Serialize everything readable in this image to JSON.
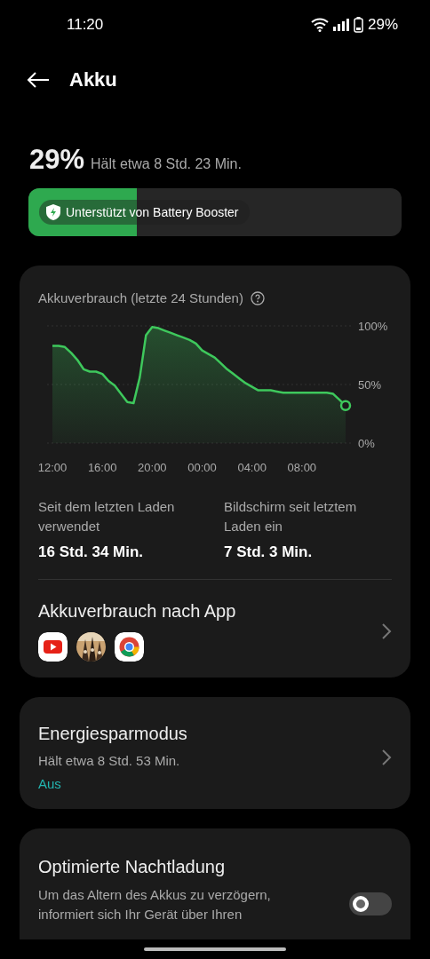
{
  "status_bar": {
    "time": "11:20",
    "battery_text": "29%"
  },
  "header": {
    "title": "Akku"
  },
  "battery": {
    "percent": "29%",
    "estimate": "Hält etwa 8 Std. 23 Min.",
    "level": 0.29,
    "badge": "Unterstützt von Battery Booster"
  },
  "usage_card": {
    "title": "Akkuverbrauch (letzte 24 Stunden)",
    "chart_data": {
      "type": "area",
      "categories": [
        "12:00",
        null,
        null,
        null,
        null,
        null,
        null,
        null,
        "16:00",
        null,
        null,
        null,
        null,
        null,
        null,
        null,
        "20:00",
        null,
        null,
        null,
        null,
        null,
        null,
        null,
        "00:00",
        null,
        null,
        null,
        null,
        null,
        null,
        null,
        "04:00",
        null,
        null,
        null,
        null,
        null,
        null,
        null,
        "08:00",
        null,
        null,
        null,
        null,
        null,
        null,
        null
      ],
      "series": [
        {
          "color": "#3ec85c",
          "values": [
            83,
            83,
            82,
            77,
            71,
            63,
            61,
            61,
            59,
            53,
            49,
            42,
            35,
            34,
            56,
            92,
            99,
            98,
            96,
            94,
            92,
            90,
            88,
            85,
            79,
            76,
            73,
            68,
            63,
            59,
            55,
            51,
            48,
            45,
            45,
            45,
            44,
            43,
            43,
            43,
            43,
            43,
            43,
            43,
            43,
            42,
            37,
            32
          ]
        }
      ],
      "ylim": [
        0,
        100
      ],
      "yticks": [
        {
          "value": 0,
          "label": "0%"
        },
        {
          "value": 50,
          "label": "50%"
        },
        {
          "value": 100,
          "label": "100%"
        }
      ]
    },
    "stats": [
      {
        "label": "Seit dem letzten Laden verwendet",
        "value": "16 Std. 34 Min."
      },
      {
        "label": "Bildschirm seit letztem Laden ein",
        "value": "7 Std. 3 Min."
      }
    ],
    "by_app": {
      "title": "Akkuverbrauch nach App",
      "apps": [
        {
          "kind": "video"
        },
        {
          "kind": "picture"
        },
        {
          "kind": "browser"
        }
      ]
    }
  },
  "power_saving": {
    "title": "Energiesparmodus",
    "subtitle": "Hält etwa 8 Std. 53 Min.",
    "status": "Aus"
  },
  "night_charging": {
    "title": "Optimierte Nachtladung",
    "description": "Um das Altern des Akkus zu verzögern, informiert sich Ihr Gerät über Ihren",
    "on": false
  }
}
